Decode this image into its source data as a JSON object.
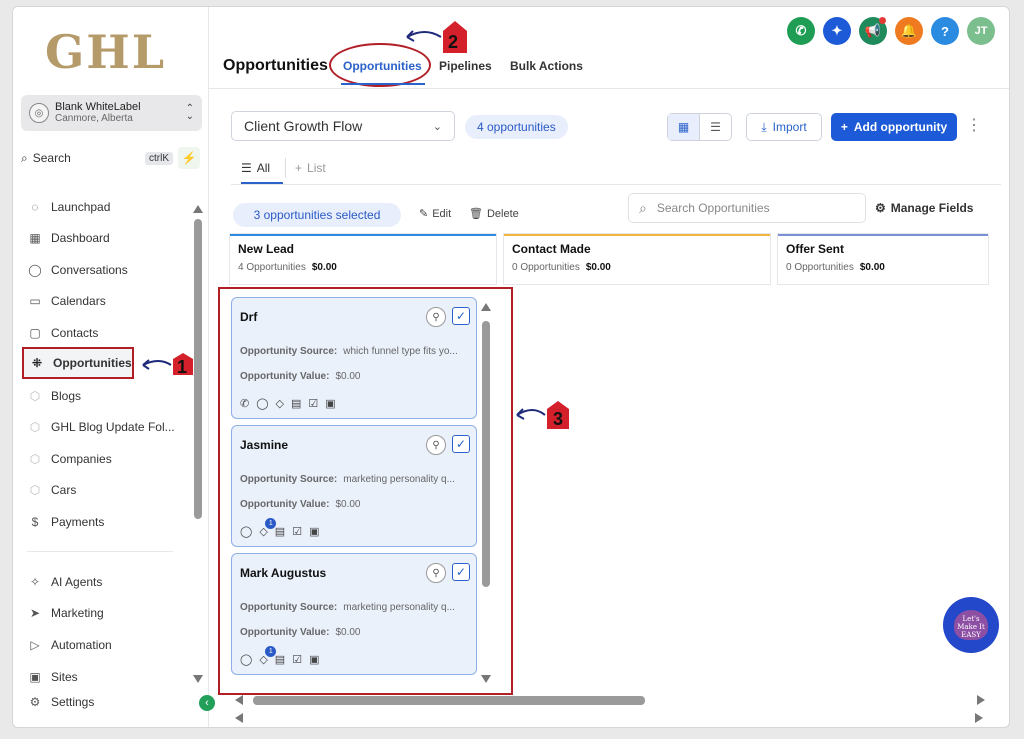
{
  "logo": "GHL",
  "account": {
    "name": "Blank WhiteLabel",
    "location": "Canmore, Alberta"
  },
  "search": {
    "label": "Search",
    "shortcut": "ctrlK"
  },
  "nav": [
    {
      "label": "Launchpad",
      "icon": "rocket-icon"
    },
    {
      "label": "Dashboard",
      "icon": "grid-icon"
    },
    {
      "label": "Conversations",
      "icon": "chat-icon"
    },
    {
      "label": "Calendars",
      "icon": "calendar-icon"
    },
    {
      "label": "Contacts",
      "icon": "contacts-icon"
    },
    {
      "label": "Opportunities",
      "icon": "opportunities-icon"
    },
    {
      "label": "Blogs",
      "icon": "cube-icon"
    },
    {
      "label": "GHL Blog Update Fol...",
      "icon": "cube-icon"
    },
    {
      "label": "Companies",
      "icon": "cube-icon"
    },
    {
      "label": "Cars",
      "icon": "cube-icon"
    },
    {
      "label": "Payments",
      "icon": "payments-icon"
    },
    {
      "label": "AI Agents",
      "icon": "sparkle-icon"
    },
    {
      "label": "Marketing",
      "icon": "send-icon"
    },
    {
      "label": "Automation",
      "icon": "automation-icon"
    },
    {
      "label": "Sites",
      "icon": "sites-icon"
    },
    {
      "label": "Settings",
      "icon": "gear-icon"
    }
  ],
  "header": {
    "title": "Opportunities",
    "tabs": [
      "Opportunities",
      "Pipelines",
      "Bulk Actions"
    ],
    "avatar_initials": "JT"
  },
  "toolbar": {
    "pipeline": "Client Growth Flow",
    "count": "4 opportunities",
    "import": "Import",
    "add": "Add opportunity"
  },
  "view_tabs": {
    "all": "All",
    "list": "List"
  },
  "selection": {
    "selected": "3 opportunities selected",
    "edit": "Edit",
    "delete": "Delete",
    "search_placeholder": "Search Opportunities",
    "manage_fields": "Manage Fields"
  },
  "columns": [
    {
      "title": "New Lead",
      "count": "4 Opportunities",
      "value": "$0.00",
      "color": "#2a8be0"
    },
    {
      "title": "Contact Made",
      "count": "0 Opportunities",
      "value": "$0.00",
      "color": "#f2b441"
    },
    {
      "title": "Offer Sent",
      "count": "0 Opportunities",
      "value": "$0.00",
      "color": "#7a8fd6"
    }
  ],
  "card_labels": {
    "source": "Opportunity Source:",
    "value": "Opportunity Value:"
  },
  "cards": [
    {
      "name": "Drf",
      "source": "which funnel type fits yo...",
      "value": "$0.00"
    },
    {
      "name": "Jasmine",
      "source": "marketing personality q...",
      "value": "$0.00",
      "badge": "1"
    },
    {
      "name": "Mark Augustus",
      "source": "marketing personality q...",
      "value": "$0.00",
      "badge": "1"
    }
  ],
  "annotations": [
    "1",
    "2",
    "3"
  ],
  "fab_text": "Let's Make It EASY"
}
